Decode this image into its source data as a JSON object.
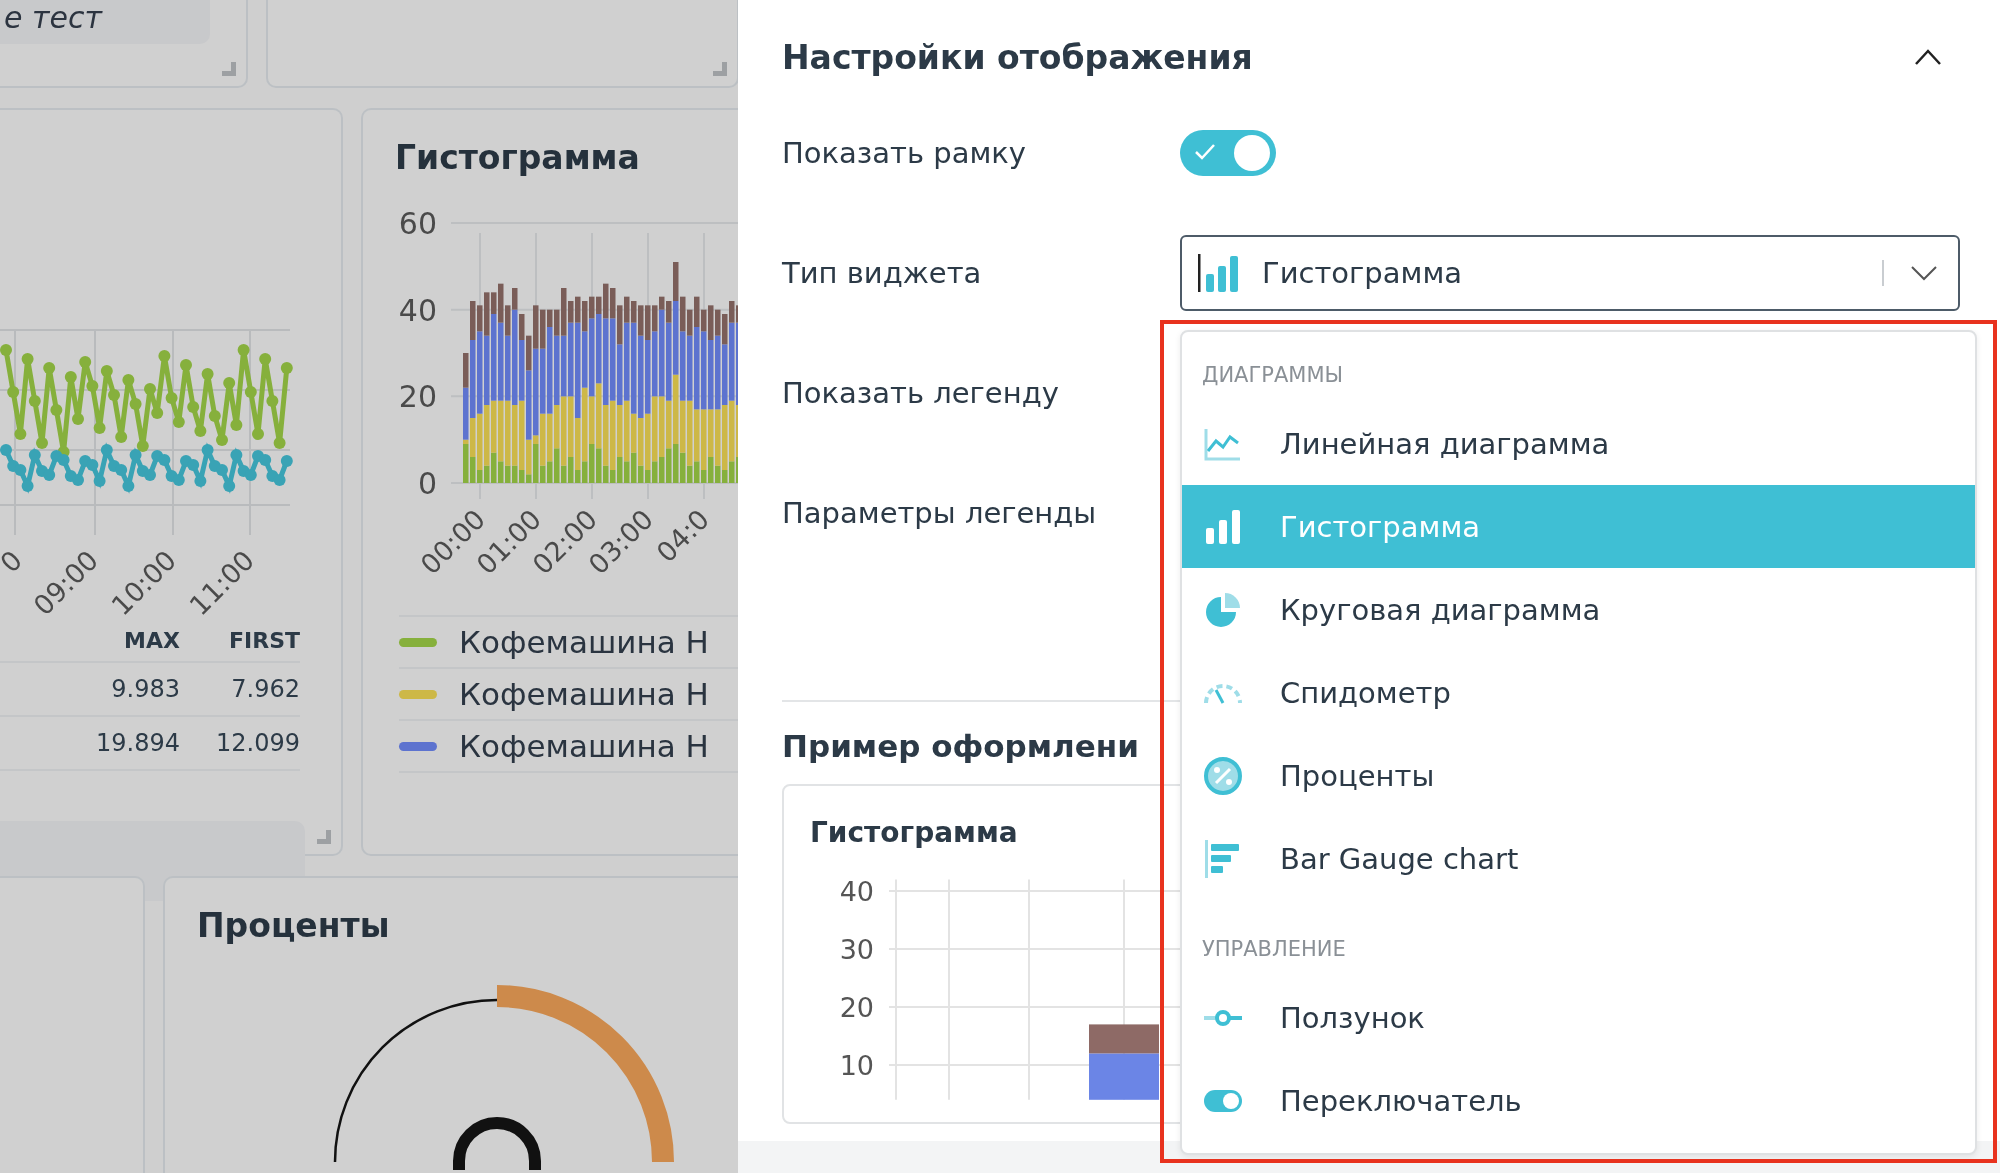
{
  "dashboard": {
    "note_card": {
      "text": "е тест"
    },
    "line_widget": {
      "x_labels": [
        "0",
        "09:00",
        "10:00",
        "11:00"
      ],
      "table": {
        "columns": [
          "MAX",
          "FIRST"
        ],
        "rows": [
          [
            "9.983",
            "7.962"
          ],
          [
            "19.894",
            "12.099"
          ]
        ]
      }
    },
    "histogram_widget": {
      "title": "Гистограмма",
      "chart_data": {
        "type": "bar",
        "stacked": true,
        "grid": true,
        "ylim": [
          0,
          60
        ],
        "yticks": [
          0,
          20,
          40,
          60
        ],
        "categories": [
          null,
          null,
          "00:00",
          null,
          null,
          null,
          null,
          null,
          null,
          null,
          "01:00",
          null,
          null,
          null,
          null,
          null,
          null,
          null,
          "02:00",
          null,
          null,
          null,
          null,
          null,
          null,
          null,
          "03:00",
          null,
          null,
          null,
          null,
          null,
          null,
          null,
          "04:0",
          null,
          null,
          null,
          null,
          null
        ],
        "series": [
          {
            "color": "#86b03c",
            "values": [
              9,
              6,
              3,
              4,
              7,
              5,
              4,
              4,
              3,
              2,
              9,
              4,
              5,
              8,
              4,
              6,
              3,
              5,
              9,
              8,
              4,
              3,
              6,
              5,
              7,
              4,
              3,
              5,
              6,
              8,
              9,
              7,
              4,
              5,
              3,
              6,
              4,
              3,
              5,
              6
            ]
          },
          {
            "color": "#cdb847",
            "values": [
              1,
              9,
              13,
              14,
              12,
              14,
              15,
              14,
              16,
              8,
              2,
              12,
              11,
              10,
              16,
              14,
              12,
              17,
              11,
              15,
              14,
              16,
              12,
              14,
              9,
              11,
              13,
              15,
              14,
              11,
              16,
              12,
              15,
              12,
              14,
              11,
              13,
              15,
              14,
              12
            ]
          },
          {
            "color": "#5d73cf",
            "values": [
              12,
              18,
              19,
              16,
              20,
              18,
              15,
              22,
              14,
              16,
              20,
              15,
              20,
              16,
              14,
              17,
              22,
              13,
              18,
              16,
              20,
              19,
              14,
              18,
              21,
              19,
              17,
              15,
              20,
              18,
              17,
              16,
              15,
              19,
              18,
              16,
              17,
              14,
              18,
              19
            ]
          },
          {
            "color": "#7a5d58",
            "values": [
              8,
              9,
              6,
              10,
              5,
              9,
              7,
              5,
              6,
              8,
              10,
              9,
              4,
              6,
              11,
              5,
              6,
              7,
              5,
              4,
              8,
              7,
              9,
              6,
              5,
              7,
              8,
              6,
              3,
              5,
              9,
              8,
              6,
              7,
              5,
              8,
              6,
              7,
              5,
              4
            ]
          }
        ]
      },
      "legend": [
        {
          "label": "Кофемашина Н",
          "color": "#86b03c"
        },
        {
          "label": "Кофемашина Н",
          "color": "#cdb847"
        },
        {
          "label": "Кофемашина Н",
          "color": "#5d73cf"
        }
      ]
    },
    "percent_widget": {
      "title": "Проценты"
    }
  },
  "settings": {
    "title": "Настройки отображения",
    "expanded": true,
    "rows": [
      {
        "label": "Показать рамку",
        "kind": "toggle",
        "on": true
      },
      {
        "label": "Тип виджета",
        "kind": "select",
        "value": "Гистограмма"
      },
      {
        "label": "Показать легенду",
        "kind": "label"
      },
      {
        "label": "Параметры легенды",
        "kind": "label"
      }
    ],
    "preview": {
      "heading": "Пример оформлени",
      "title": "Гистограмма",
      "chart_data": {
        "type": "bar",
        "stacked": true,
        "grid": true,
        "ylim": [
          4,
          42
        ],
        "yticks": [
          10,
          20,
          30,
          40
        ],
        "categories": [
          null,
          null,
          null
        ],
        "series": [
          {
            "color": "#6b85e6",
            "values": [
              null,
              null,
              12
            ]
          },
          {
            "color": "#8e6a66",
            "values": [
              null,
              null,
              5
            ]
          }
        ]
      }
    }
  },
  "dropdown": {
    "groups": [
      {
        "title": "ДИАГРАММЫ",
        "items": [
          {
            "label": "Линейная диаграмма",
            "kind": "line",
            "selected": false
          },
          {
            "label": "Гистограмма",
            "kind": "bar",
            "selected": true
          },
          {
            "label": "Круговая диаграмма",
            "kind": "pie",
            "selected": false
          },
          {
            "label": "Спидометр",
            "kind": "gauge",
            "selected": false
          },
          {
            "label": "Проценты",
            "kind": "percent",
            "selected": false
          },
          {
            "label": "Bar Gauge chart",
            "kind": "bargauge",
            "selected": false
          }
        ]
      },
      {
        "title": "УПРАВЛЕНИЕ",
        "items": [
          {
            "label": "Ползунок",
            "kind": "slider",
            "selected": false
          },
          {
            "label": "Переключатель",
            "kind": "switch",
            "selected": false
          }
        ]
      }
    ]
  }
}
